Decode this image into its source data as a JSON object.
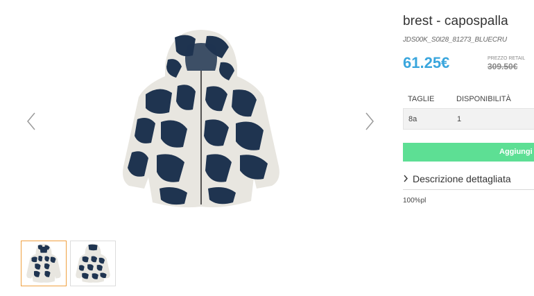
{
  "gallery": {
    "prev_icon": "chevron-left-icon",
    "next_icon": "chevron-right-icon",
    "colors": {
      "dark": "#1f3450",
      "light": "#e8e6e0",
      "thumb_active_border": "#f0a040"
    }
  },
  "product": {
    "title": "brest - capospalla",
    "sku": "JDS00K_S0I28_81273_BLUECRU",
    "price": "61.25€",
    "retail_label": "PREZZO RETAIL",
    "retail_price": "309.50€"
  },
  "sizes": {
    "header_size": "TAGLIE",
    "header_availability": "DISPONIBILITÀ",
    "rows": [
      {
        "size": "8a",
        "availability": "1"
      }
    ]
  },
  "actions": {
    "add_label": "Aggiungi a",
    "add_color": "#5ddf94"
  },
  "description": {
    "toggle_label": "Descrizione dettagliata",
    "material": "100%pl"
  },
  "accent": "#3aa6dd"
}
